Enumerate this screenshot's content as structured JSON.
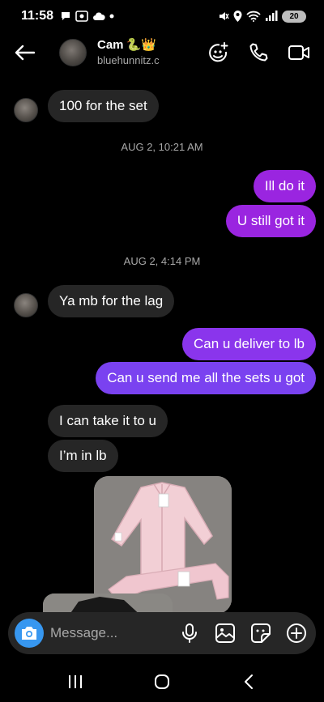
{
  "status_bar": {
    "time": "11:58",
    "battery": "20"
  },
  "header": {
    "name": "Cam",
    "name_emoji": "🐍👑",
    "username": "bluehunnitz.c"
  },
  "messages": [
    {
      "kind": "incoming",
      "text": "100 for the set"
    },
    {
      "kind": "timestamp",
      "text": "AUG 2, 10:21 AM"
    },
    {
      "kind": "outgoing",
      "text": "Ill do it"
    },
    {
      "kind": "outgoing",
      "text": "U still got it"
    },
    {
      "kind": "timestamp",
      "text": "AUG 2, 4:14 PM"
    },
    {
      "kind": "incoming",
      "text": "Ya mb for the lag"
    },
    {
      "kind": "outgoing",
      "text": "Can u deliver to lb"
    },
    {
      "kind": "outgoing",
      "text": "Can u send me all the sets u got"
    },
    {
      "kind": "incoming",
      "text": "I can take it to u"
    },
    {
      "kind": "incoming",
      "text": "I’m in lb"
    },
    {
      "kind": "photo",
      "icon": "clothing-photo"
    }
  ],
  "composer": {
    "placeholder": "Message..."
  },
  "colors": {
    "background": "#000000",
    "incoming_bubble": "#262626",
    "outgoing_bubble_top": "#9a25e0",
    "outgoing_bubble_bottom": "#7a42f0",
    "camera_button": "#3797f0"
  },
  "icons": {
    "header": [
      "back-arrow-icon",
      "add-person-icon",
      "phone-icon",
      "video-camera-icon"
    ],
    "composer": [
      "camera-icon",
      "microphone-icon",
      "gallery-icon",
      "sticker-icon",
      "plus-circle-icon"
    ],
    "nav": [
      "recents-icon",
      "home-icon",
      "back-icon"
    ]
  }
}
